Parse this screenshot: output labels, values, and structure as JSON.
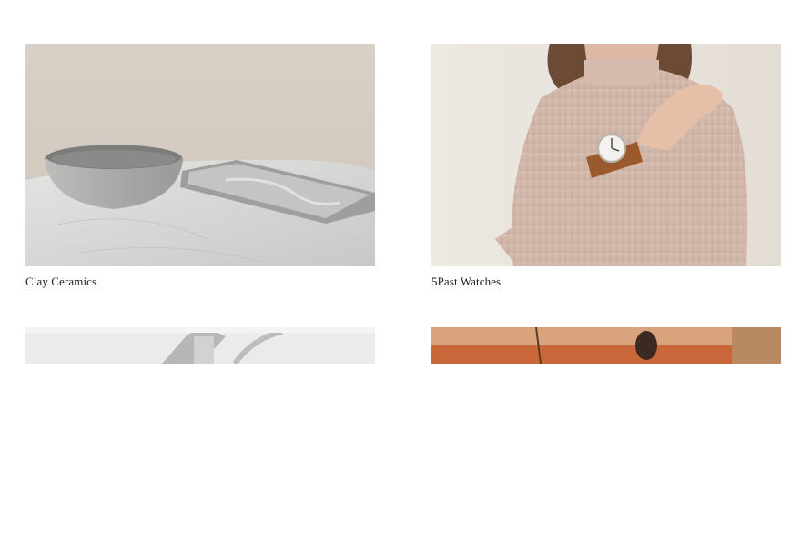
{
  "products": [
    {
      "title": "Clay Ceramics",
      "image_icon": "ceramics-photo"
    },
    {
      "title": "5Past Watches",
      "image_icon": "watch-photo"
    },
    {
      "title": "",
      "image_icon": "grey-product-photo"
    },
    {
      "title": "",
      "image_icon": "orange-product-photo"
    }
  ]
}
